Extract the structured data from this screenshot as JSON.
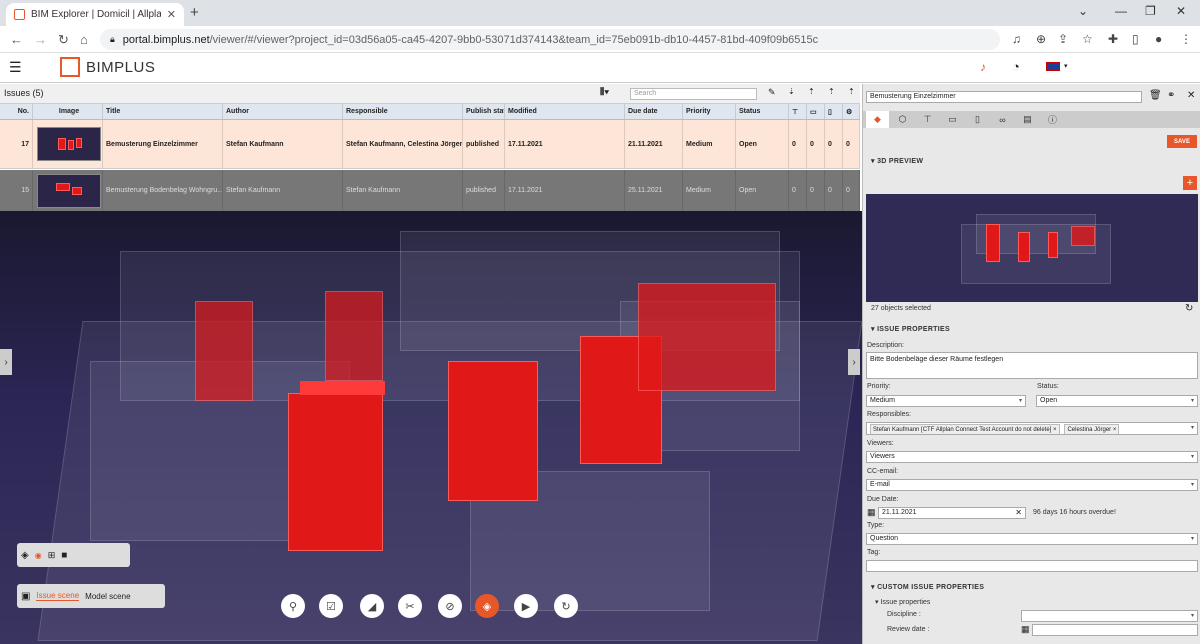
{
  "browser": {
    "tab_title": "BIM Explorer | Domicil | Allplan B",
    "url_host": "portal.bimplus.net",
    "url_path": "/viewer/#/viewer?project_id=03d56a05-ca45-4207-9bb0-53071d374143&team_id=75eb091b-db10-4457-81bd-409f09b6515c"
  },
  "app": {
    "logo_text": "BIMPLUS"
  },
  "issues": {
    "title": "Issues (5)",
    "search_placeholder": "Search",
    "columns": [
      "No.",
      "Image",
      "Title",
      "Author",
      "Responsible",
      "Publish stat",
      "Modified",
      "Due date",
      "Priority",
      "Status"
    ],
    "count_cols": [
      "BCF",
      "BCF",
      "XLS"
    ],
    "rows": [
      {
        "no": "17",
        "title": "Bemusterung Einzelzimmer",
        "author": "Stefan Kaufmann",
        "responsible": "Stefan Kaufmann, Celestina Jörger",
        "publish": "published",
        "modified": "17.11.2021",
        "due": "21.11.2021",
        "priority": "Medium",
        "status": "Open",
        "c1": "0",
        "c2": "0",
        "c3": "0",
        "c4": "0"
      },
      {
        "no": "15",
        "title": "Bemusterung Bodenbelag Wohngru...",
        "author": "Stefan Kaufmann",
        "responsible": "Stefan Kaufmann",
        "publish": "published",
        "modified": "17.11.2021",
        "due": "25.11.2021",
        "priority": "Medium",
        "status": "Open",
        "c1": "0",
        "c2": "0",
        "c3": "0",
        "c4": "0"
      }
    ]
  },
  "viewer": {
    "scene_tab_issue": "Issue scene",
    "scene_tab_model": "Model scene"
  },
  "panel": {
    "title_value": "Bemusterung Einzelzimmer",
    "save_label": "SAVE",
    "preview_header": "3D PREVIEW",
    "objects_selected": "27 objects selected",
    "props_header": "ISSUE PROPERTIES",
    "description_label": "Description:",
    "description_value": "Bitte Bodenbeläge dieser Räume festlegen",
    "priority_label": "Priority:",
    "priority_value": "Medium",
    "status_label": "Status:",
    "status_value": "Open",
    "responsibles_label": "Responsibles:",
    "responsible_1": "Stefan Kaufmann [CTF Allplan Connect Test Account do not delete]",
    "responsible_2": "Celestina Jörger",
    "viewers_label": "Viewers:",
    "viewers_value": "Viewers",
    "cc_label": "CC-email:",
    "cc_value": "E-mail",
    "due_label": "Due Date:",
    "due_value": "21.11.2021",
    "overdue_text": "96 days 16 hours overdue!",
    "type_label": "Type:",
    "type_value": "Question",
    "tag_label": "Tag:",
    "custom_header": "CUSTOM ISSUE PROPERTIES",
    "custom_group": "Issue properties",
    "discipline_label": "Discipline :",
    "review_label": "Review date :"
  },
  "colors": {
    "accent": "#e8572a",
    "highlight": "#e01818"
  }
}
